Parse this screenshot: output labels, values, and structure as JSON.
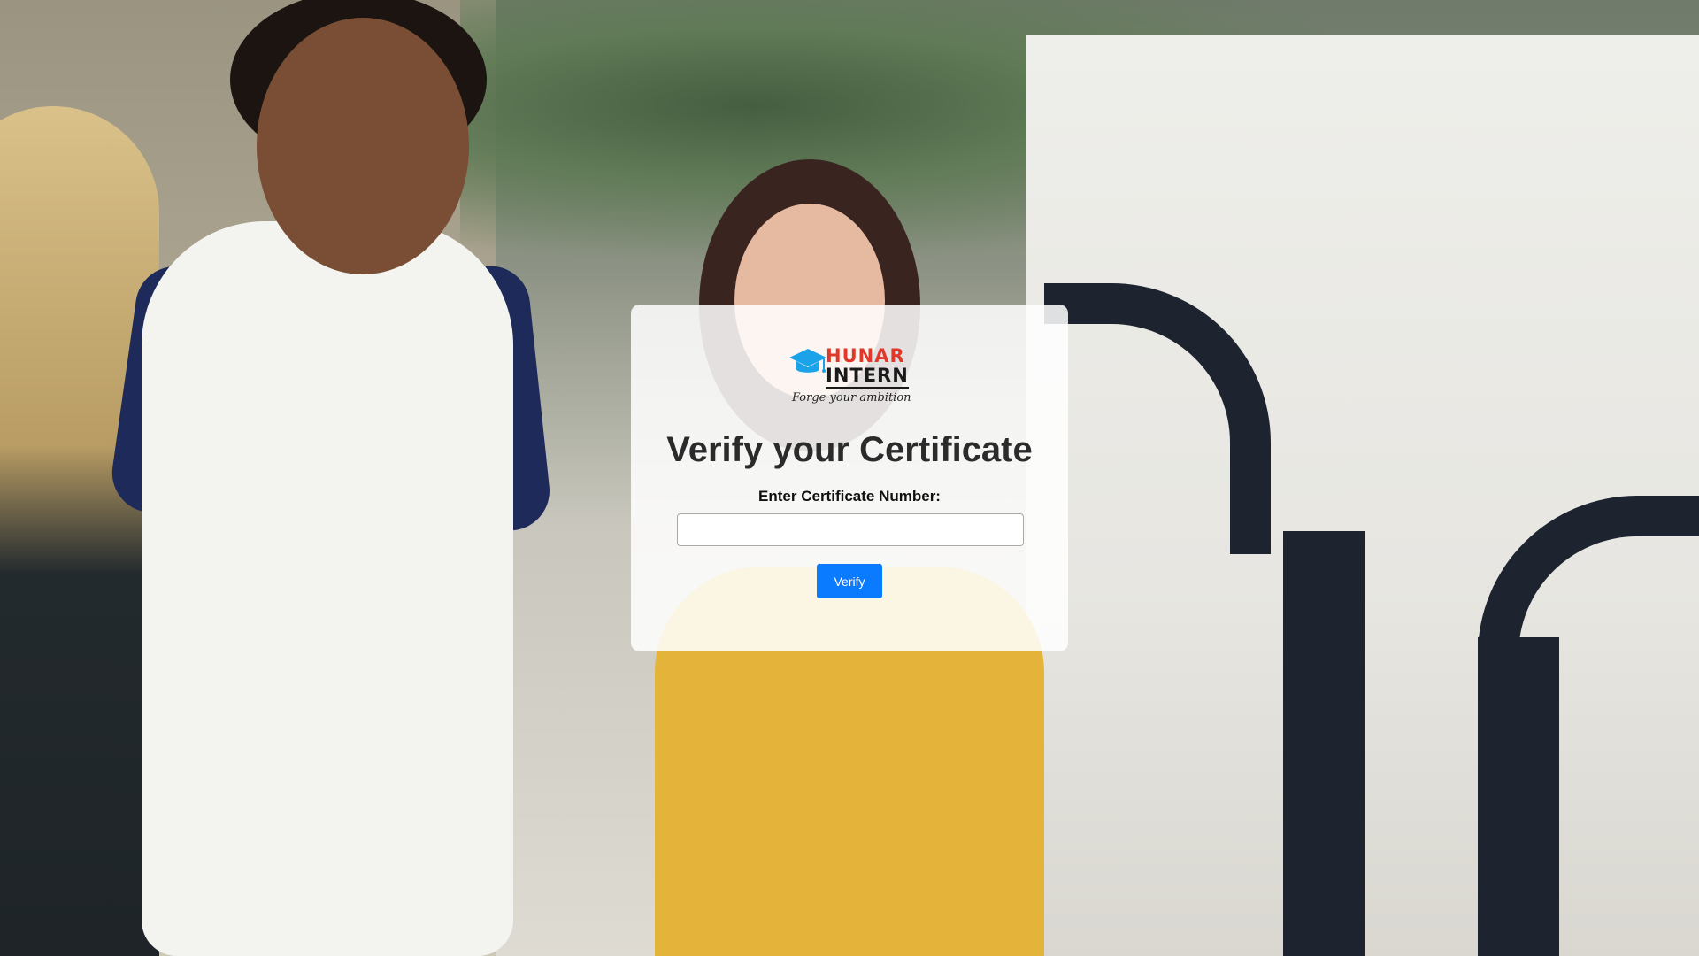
{
  "logo": {
    "brand_line1": "HUNAR",
    "brand_line2": "INTERN",
    "tagline": "Forge your ambition",
    "icon": "graduation-cap-icon",
    "colors": {
      "cap": "#1aa3e8",
      "line1": "#e0392b",
      "line2": "#1a1a1a"
    }
  },
  "form": {
    "title": "Verify your Certificate",
    "field_label": "Enter Certificate Number:",
    "input_value": "",
    "input_placeholder": "",
    "submit_label": "Verify"
  },
  "colors": {
    "accent": "#0a7bff",
    "card_background": "rgba(255,255,255,0.86)",
    "title_text": "#2b2b2b"
  }
}
